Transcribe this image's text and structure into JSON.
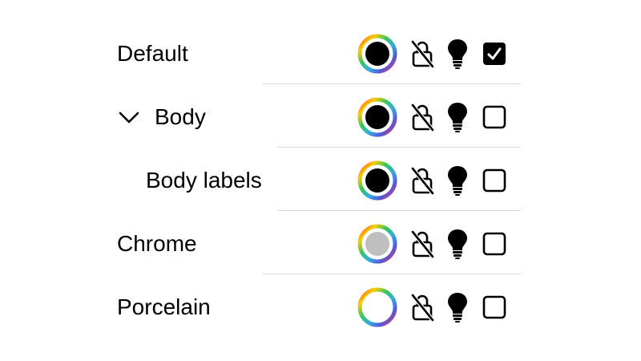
{
  "rows": [
    {
      "label": "Default",
      "swatch_color": "#000000",
      "checked": true,
      "indent": 0,
      "expandable": false
    },
    {
      "label": "Body",
      "swatch_color": "#000000",
      "checked": false,
      "indent": 0,
      "expandable": true,
      "expanded": true
    },
    {
      "label": "Body labels",
      "swatch_color": "#000000",
      "checked": false,
      "indent": 1,
      "expandable": false
    },
    {
      "label": "Chrome",
      "swatch_color": "#bfbfbf",
      "checked": false,
      "indent": 0,
      "expandable": false
    },
    {
      "label": "Porcelain",
      "swatch_color": "#ffffff",
      "checked": false,
      "indent": 0,
      "expandable": false
    }
  ],
  "icons": {
    "chevron": "chevron-down-icon",
    "swatch": "color-picker-icon",
    "lock": "lock-slash-icon",
    "bulb": "lightbulb-icon",
    "checkbox": "checkbox-icon"
  },
  "colors": {
    "checkbox_border": "#000000",
    "divider": "#d9d9d9"
  }
}
